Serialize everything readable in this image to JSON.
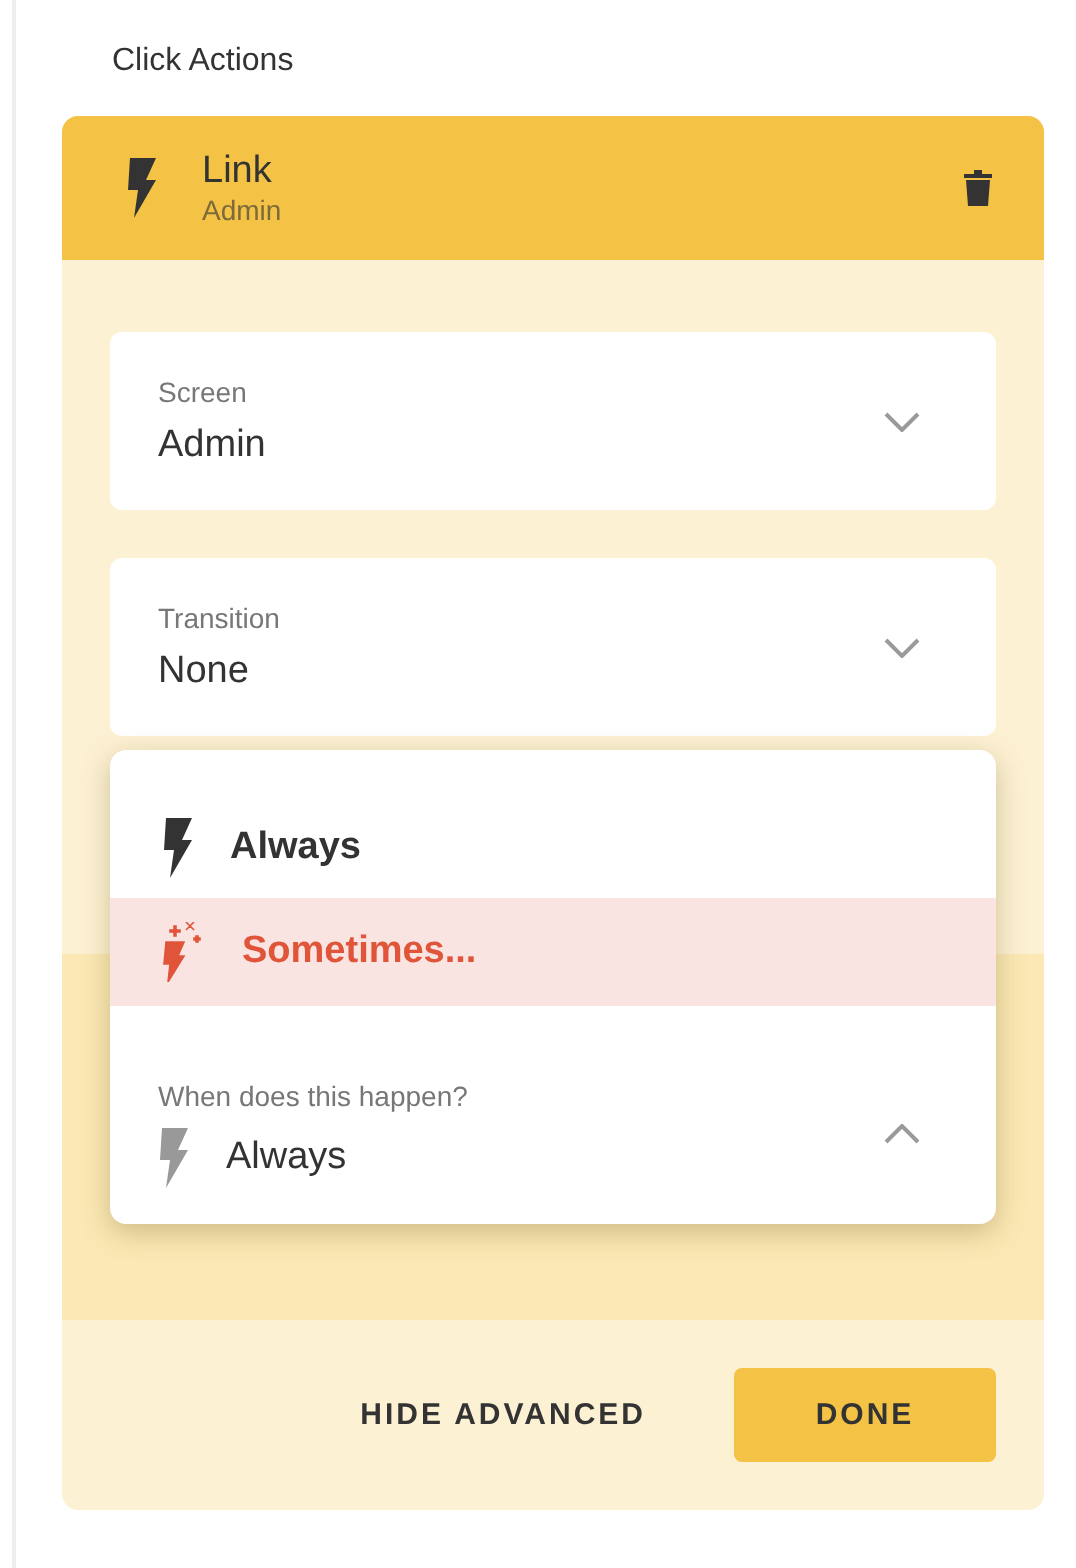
{
  "section_title": "Click Actions",
  "action": {
    "title": "Link",
    "subtitle": "Admin"
  },
  "fields": [
    {
      "label": "Screen",
      "value": "Admin",
      "expanded": false
    },
    {
      "label": "Transition",
      "value": "None",
      "expanded": false
    }
  ],
  "dropdown": {
    "options": [
      {
        "label": "Always",
        "kind": "always",
        "selected": false
      },
      {
        "label": "Sometimes...",
        "kind": "sometimes",
        "selected": true
      }
    ],
    "select": {
      "label": "When does this happen?",
      "value": "Always",
      "expanded": true
    }
  },
  "buttons": [
    {
      "label": "HIDE ADVANCED",
      "kind": "text"
    },
    {
      "label": "DONE",
      "kind": "primary"
    }
  ]
}
